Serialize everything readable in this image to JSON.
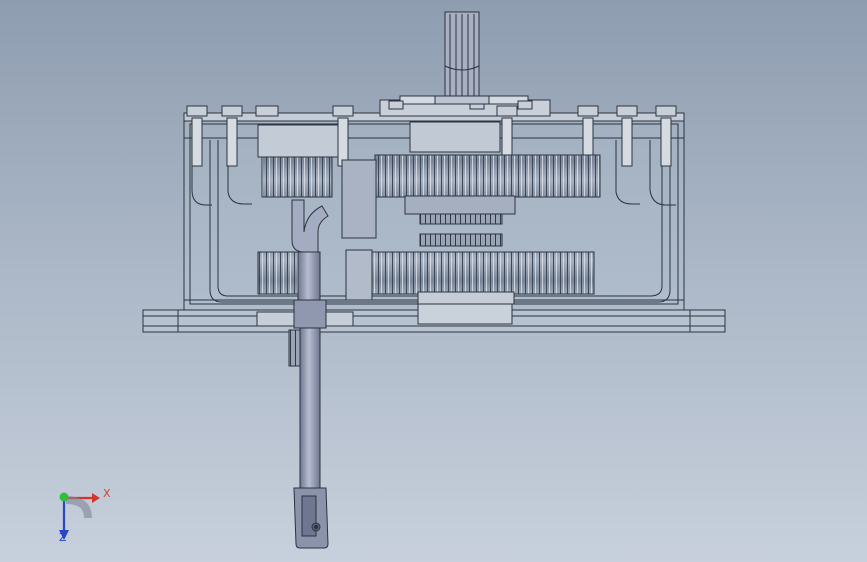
{
  "viewport": {
    "background_top": "#8e9db0",
    "background_bottom": "#c7d0dc",
    "edge_color": "#2b3440",
    "body_fill": "#b9c4d2",
    "gear_fill": "#8a97aa",
    "shaft_fill": "#9aa2b8"
  },
  "triad": {
    "x_label": "X",
    "z_label": "Z",
    "x_color": "#d8322a",
    "y_color": "#2fbf3b",
    "z_color": "#2746c8"
  }
}
